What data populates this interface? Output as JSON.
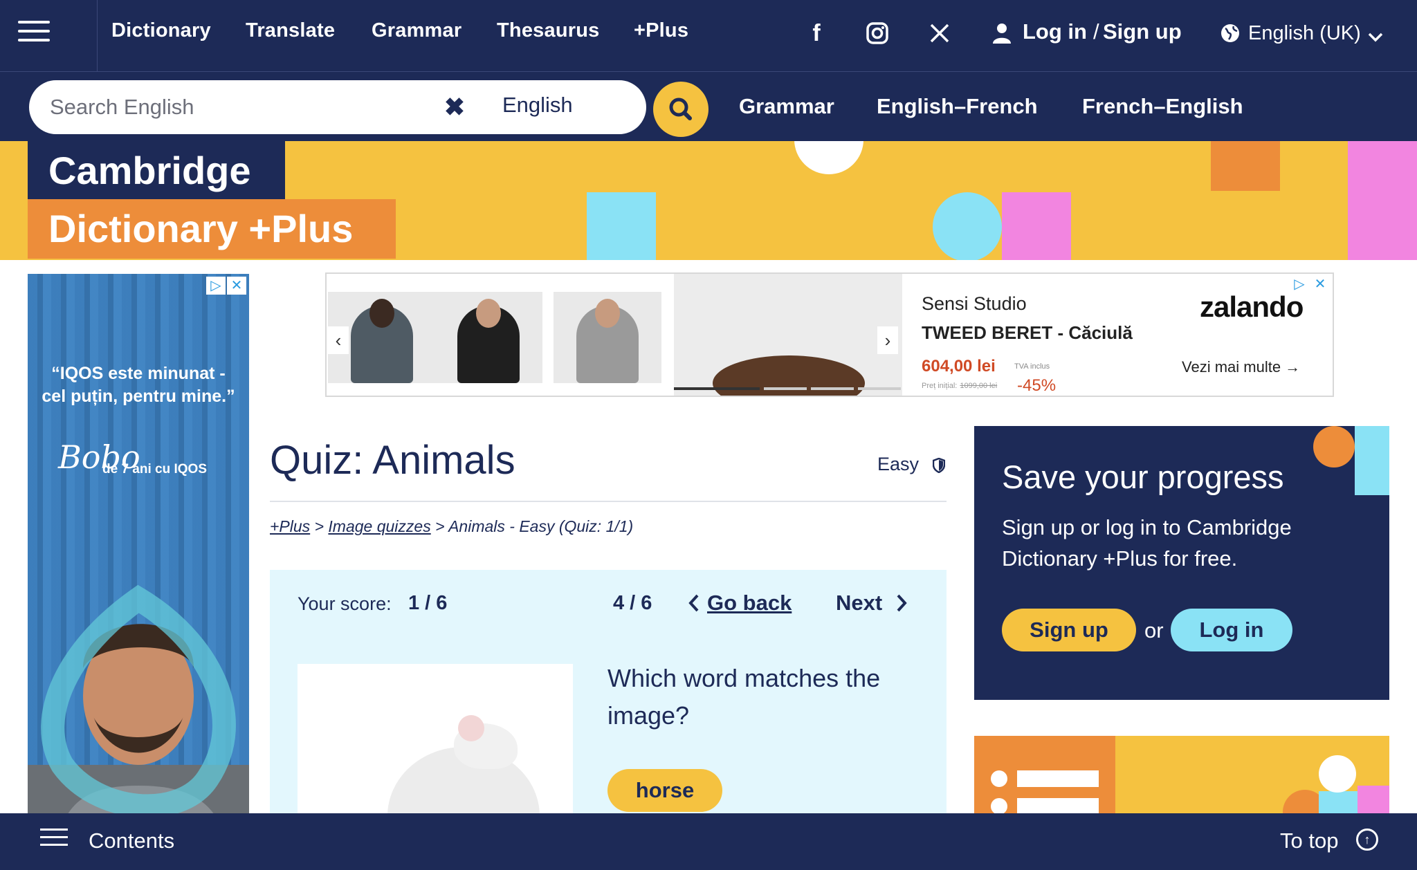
{
  "topnav": {
    "links": [
      "Dictionary",
      "Translate",
      "Grammar",
      "Thesaurus",
      "+Plus"
    ],
    "auth": {
      "login": "Log in",
      "separator": "/",
      "signup": "Sign up"
    },
    "language": "English (UK)",
    "icons": [
      "menu-icon",
      "facebook-icon",
      "instagram-icon",
      "x-icon",
      "user-icon",
      "globe-icon",
      "chevron-down-icon"
    ]
  },
  "search": {
    "placeholder": "Search English",
    "dictionary": "English",
    "subnav": [
      "Grammar",
      "English–French",
      "French–English"
    ]
  },
  "banner": {
    "line1": "Cambridge",
    "line2": "Dictionary +Plus"
  },
  "left_ad": {
    "quote": "“IQOS este minunat - cel puțin, pentru mine.”",
    "signature": "Bobo",
    "since": "de 7 ani cu IQOS"
  },
  "top_ad": {
    "brand": "Sensi Studio",
    "title": "TWEED BERET - Căciulă",
    "price": "604,00 lei",
    "vat": "TVA inclus",
    "old_label": "Preț inițial:",
    "old_price": "1099,00 lei",
    "discount": "-45%",
    "store": "zalando",
    "more": "Vezi mai multe →"
  },
  "quiz": {
    "title": "Quiz: Animals",
    "level": "Easy",
    "breadcrumb": {
      "plus": "+Plus",
      "sep": ">",
      "image_quizzes": "Image quizzes",
      "current": "> Animals - Easy (Quiz: 1/1)"
    },
    "score_label": "Your score:",
    "score": "1 / 6",
    "progress": "4 / 6",
    "go_back": "Go back",
    "next": "Next",
    "question": "Which word matches the image?",
    "answer": "horse"
  },
  "save": {
    "title": "Save your progress",
    "text": "Sign up or log in to Cambridge Dictionary +Plus for free.",
    "signup": "Sign up",
    "or": "or",
    "login": "Log in"
  },
  "bottom": {
    "contents": "Contents",
    "to_top": "To top"
  },
  "colors": {
    "navy": "#1d2a57",
    "yellow": "#f5c240",
    "orange": "#ed8d3a",
    "cyan": "#8ae2f5",
    "pink": "#f285e0"
  }
}
